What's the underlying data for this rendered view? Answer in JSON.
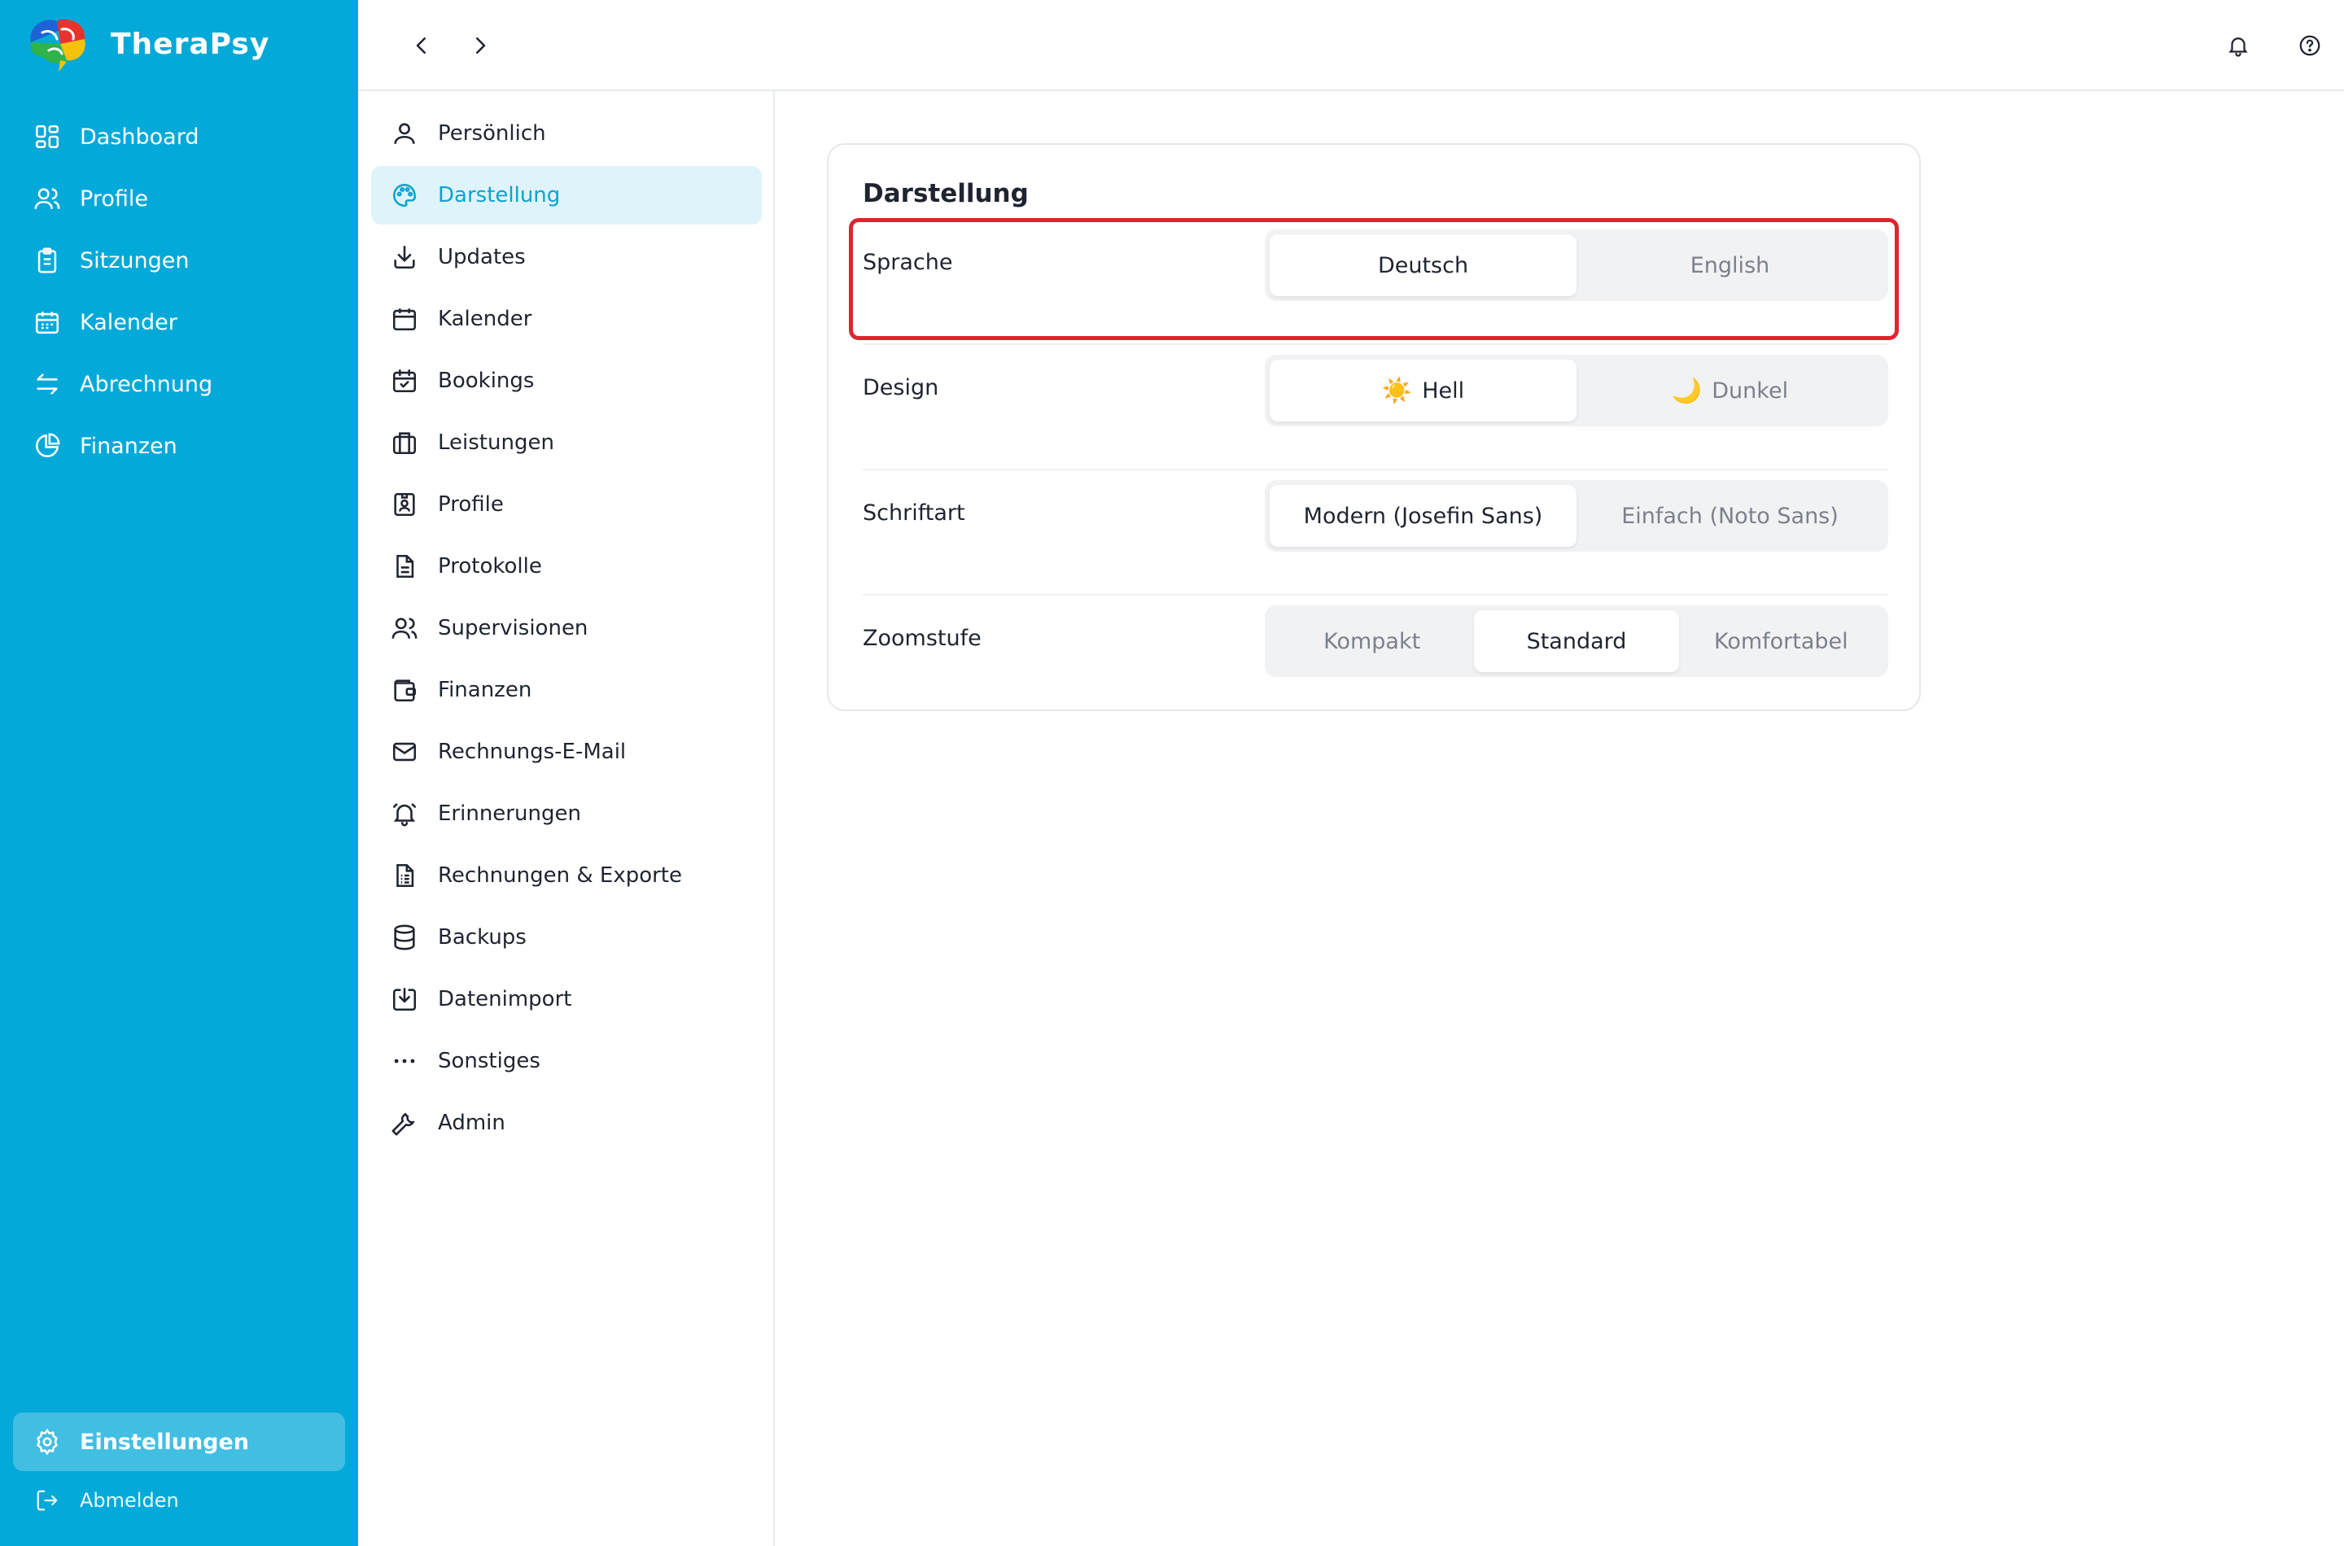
{
  "app": {
    "name": "TheraPsy"
  },
  "main_nav": [
    {
      "label": "Dashboard",
      "icon": "dashboard-icon"
    },
    {
      "label": "Profile",
      "icon": "users-icon"
    },
    {
      "label": "Sitzungen",
      "icon": "clipboard-icon"
    },
    {
      "label": "Kalender",
      "icon": "calendar-icon"
    },
    {
      "label": "Abrechnung",
      "icon": "transfer-arrows-icon"
    },
    {
      "label": "Finanzen",
      "icon": "pie-chart-icon"
    }
  ],
  "sidebar_bottom": {
    "settings": {
      "label": "Einstellungen",
      "icon": "gear-icon",
      "active": true
    },
    "logout": {
      "label": "Abmelden",
      "icon": "logout-icon"
    }
  },
  "settings_nav": [
    {
      "label": "Persönlich",
      "icon": "user-icon"
    },
    {
      "label": "Darstellung",
      "icon": "palette-icon",
      "active": true
    },
    {
      "label": "Updates",
      "icon": "download-icon"
    },
    {
      "label": "Kalender",
      "icon": "calendar-icon"
    },
    {
      "label": "Bookings",
      "icon": "calendar-check-icon"
    },
    {
      "label": "Leistungen",
      "icon": "briefcase-icon"
    },
    {
      "label": "Profile",
      "icon": "id-badge-icon"
    },
    {
      "label": "Protokolle",
      "icon": "document-icon"
    },
    {
      "label": "Supervisionen",
      "icon": "users-icon"
    },
    {
      "label": "Finanzen",
      "icon": "wallet-icon"
    },
    {
      "label": "Rechnungs-E-Mail",
      "icon": "mail-icon"
    },
    {
      "label": "Erinnerungen",
      "icon": "bell-ring-icon"
    },
    {
      "label": "Rechnungen & Exporte",
      "icon": "invoice-icon"
    },
    {
      "label": "Backups",
      "icon": "database-icon"
    },
    {
      "label": "Datenimport",
      "icon": "import-icon"
    },
    {
      "label": "Sonstiges",
      "icon": "more-dots-icon"
    },
    {
      "label": "Admin",
      "icon": "wrench-icon"
    }
  ],
  "card": {
    "title": "Darstellung",
    "rows": [
      {
        "label": "Sprache",
        "options": [
          {
            "label": "Deutsch",
            "selected": true
          },
          {
            "label": "English",
            "selected": false
          }
        ]
      },
      {
        "label": "Design",
        "options": [
          {
            "icon": "☀️",
            "label": "Hell",
            "selected": true
          },
          {
            "icon": "🌙",
            "label": "Dunkel",
            "selected": false
          }
        ]
      },
      {
        "label": "Schriftart",
        "options": [
          {
            "label": "Modern (Josefin Sans)",
            "selected": true
          },
          {
            "label": "Einfach (Noto Sans)",
            "selected": false
          }
        ]
      },
      {
        "label": "Zoomstufe",
        "options": [
          {
            "label": "Kompakt",
            "selected": false
          },
          {
            "label": "Standard",
            "selected": true
          },
          {
            "label": "Komfortabel",
            "selected": false
          }
        ]
      }
    ]
  },
  "colors": {
    "sidebar": "#03a9d8",
    "accent": "#0aa3d0",
    "active_sub_bg": "#dff3fa",
    "highlight": "#e0242f"
  }
}
